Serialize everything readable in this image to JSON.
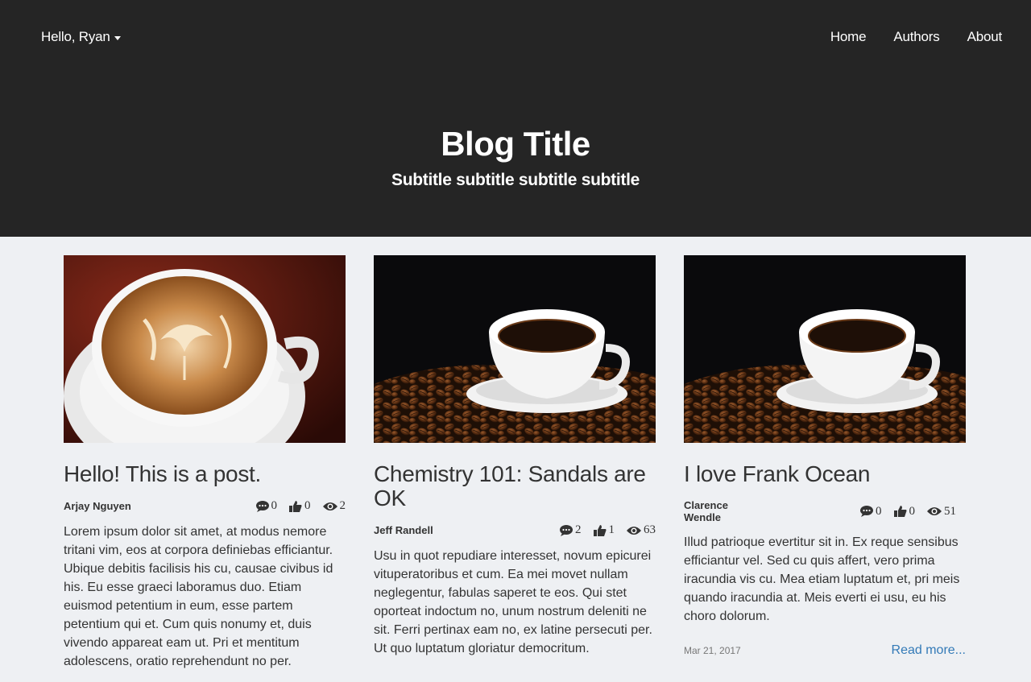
{
  "nav": {
    "user_greeting": "Hello, Ryan",
    "links": [
      "Home",
      "Authors",
      "About"
    ]
  },
  "hero": {
    "title": "Blog Title",
    "subtitle": "Subtitle subtitle subtitle subtitle"
  },
  "posts": [
    {
      "title": "Hello! This is a post.",
      "author": "Arjay Nguyen",
      "comments": "0",
      "likes": "0",
      "views": "2",
      "excerpt": "Lorem ipsum dolor sit amet, at modus nemore tritani vim, eos at corpora definiebas efficiantur. Ubique debitis facilisis his cu, causae civibus id his. Eu esse graeci laboramus duo. Etiam euismod petentium in eum, esse partem petentium qui et. Cum quis nonumy et, duis vivendo appareat eam ut. Pri et mentitum adolescens, oratio reprehendunt no per.",
      "image": "latte-art-icon"
    },
    {
      "title": "Chemistry 101: Sandals are OK",
      "author": "Jeff Randell",
      "comments": "2",
      "likes": "1",
      "views": "63",
      "excerpt": "Usu in quot repudiare interesset, novum epicurei vituperatoribus et cum. Ea mei movet nullam neglegentur, fabulas saperet te eos. Qui stet oporteat indoctum no, unum nostrum deleniti ne sit. Ferri pertinax eam no, ex latine persecuti per. Ut quo luptatum gloriatur democritum.",
      "image": "coffee-beans-icon"
    },
    {
      "title": "I love Frank Ocean",
      "author": "Clarence Wendle",
      "comments": "0",
      "likes": "0",
      "views": "51",
      "excerpt": "Illud patrioque evertitur sit in. Ex reque sensibus efficiantur vel. Sed cu quis affert, vero prima iracundia vis cu. Mea etiam luptatum et, pri meis quando iracundia at. Meis everti ei usu, eu his choro dolorum.",
      "date": "Mar 21, 2017",
      "read_more": "Read more...",
      "image": "coffee-beans-icon"
    }
  ]
}
